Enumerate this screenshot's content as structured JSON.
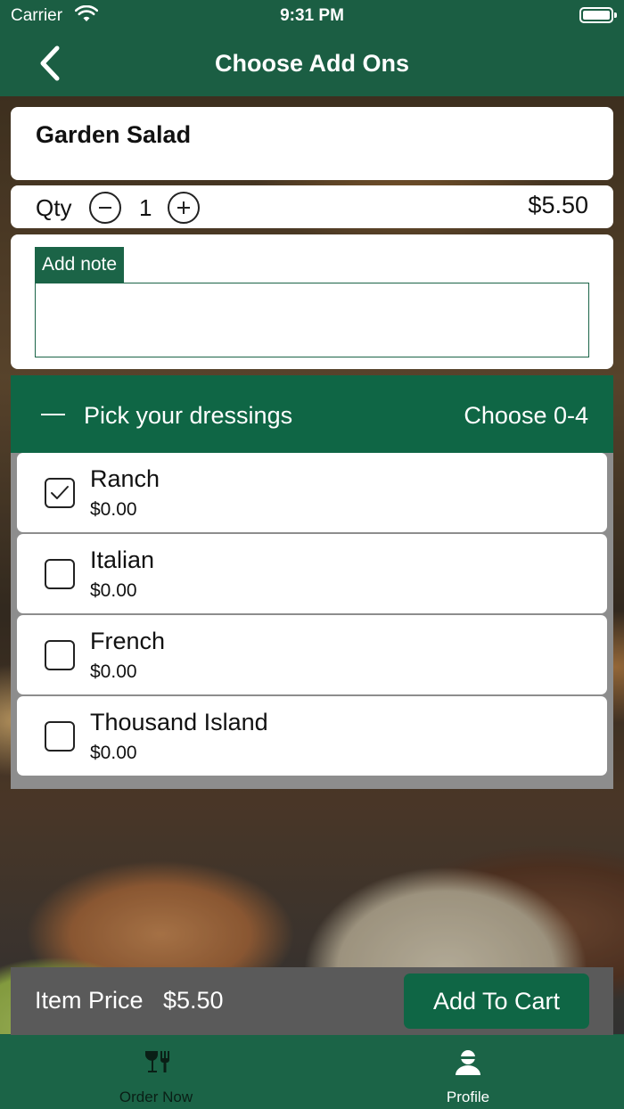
{
  "status_bar": {
    "carrier": "Carrier",
    "time": "9:31 PM"
  },
  "nav": {
    "title": "Choose Add Ons",
    "back_icon": "chevron-left-icon"
  },
  "item": {
    "name": "Garden Salad",
    "qty_label": "Qty",
    "qty_value": "1",
    "price": "$5.50"
  },
  "note": {
    "label": "Add note",
    "value": ""
  },
  "section": {
    "title": "Pick your dressings",
    "limit": "Choose 0-4",
    "options": [
      {
        "name": "Ranch",
        "price": "$0.00",
        "checked": true
      },
      {
        "name": "Italian",
        "price": "$0.00",
        "checked": false
      },
      {
        "name": "French",
        "price": "$0.00",
        "checked": false
      },
      {
        "name": "Thousand Island",
        "price": "$0.00",
        "checked": false
      }
    ]
  },
  "footer": {
    "item_price_label": "Item Price",
    "item_price_value": "$5.50",
    "add_to_cart_label": "Add To Cart"
  },
  "tabs": [
    {
      "label": "Order Now",
      "icon": "utensils-icon",
      "active": false
    },
    {
      "label": "Profile",
      "icon": "profile-icon",
      "active": true
    }
  ],
  "colors": {
    "brand_green": "#1b6447",
    "section_green": "#0f6645",
    "action_bar_gray": "#5a5a5a"
  }
}
